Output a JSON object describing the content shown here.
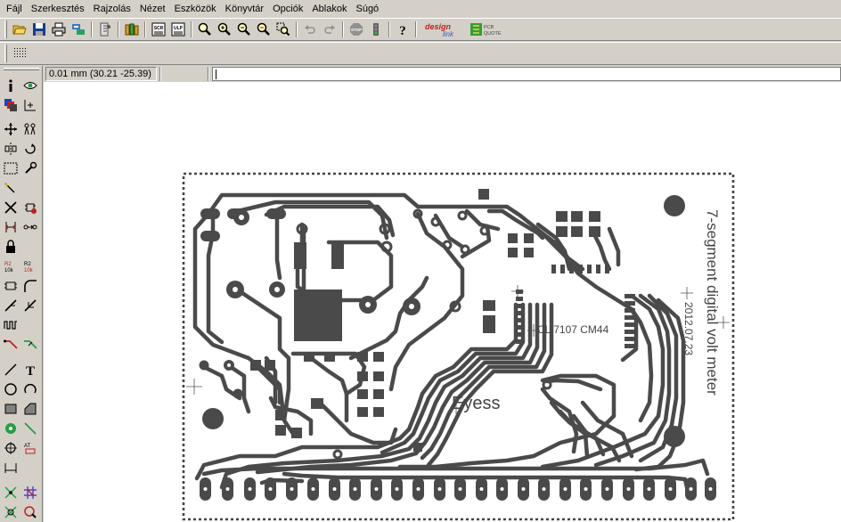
{
  "menu": {
    "items": [
      "Fájl",
      "Szerkesztés",
      "Rajzolás",
      "Nézet",
      "Eszközök",
      "Könyvtár",
      "Opciók",
      "Ablakok",
      "Súgó"
    ]
  },
  "toolbar": {
    "buttons": [
      "open-icon",
      "save-icon",
      "print-icon",
      "export-icon",
      "run-icon",
      "library-icon",
      "scr-icon",
      "ulp-icon",
      "zoom-icon",
      "zoom-in-icon",
      "zoom-out-icon",
      "zoom-prev-icon",
      "zoom-select-icon",
      "undo-icon",
      "redo-icon",
      "stop-icon",
      "go-icon",
      "help-icon"
    ],
    "scr_label": "SCR",
    "ulp_label": "ULP",
    "designlink_label": "design link",
    "pcbquote_label": "PCB QUOTE"
  },
  "status": {
    "coordinate": "0.01 mm (30.21 -25.39)",
    "command": ""
  },
  "board": {
    "title": "7-segment digital volt meter",
    "date": "2012.07.23",
    "chip_label": "CL 7107 CM44",
    "author": "Eyess"
  },
  "colors": {
    "ui_face": "#d4d0c8",
    "canvas": "#ffffff",
    "copper": "#4a4a4a"
  }
}
